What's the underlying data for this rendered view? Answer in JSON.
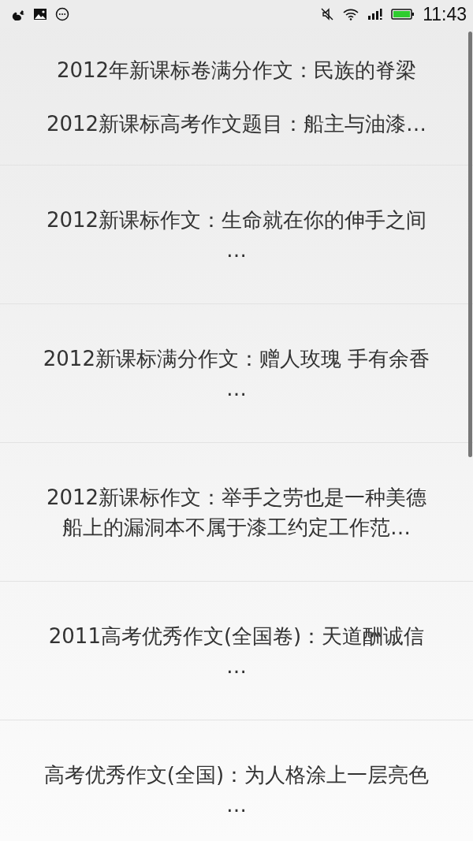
{
  "status_bar": {
    "time": "11:43"
  },
  "articles": [
    {
      "lines": [
        "2012年新课标卷满分作文：民族的脊梁",
        "2012新课标高考作文题目：船主与油漆…"
      ]
    },
    {
      "lines": [
        "2012新课标作文：生命就在你的伸手之间",
        "…"
      ]
    },
    {
      "lines": [
        "2012新课标满分作文：赠人玫瑰 手有余香",
        "…"
      ]
    },
    {
      "lines": [
        "2012新课标作文：举手之劳也是一种美德",
        "船上的漏洞本不属于漆工约定工作范…"
      ]
    },
    {
      "lines": [
        "2011高考优秀作文(全国卷)：天道酬诚信",
        "…"
      ]
    },
    {
      "lines": [
        "高考优秀作文(全国)：为人格涂上一层亮色",
        "…"
      ]
    }
  ]
}
